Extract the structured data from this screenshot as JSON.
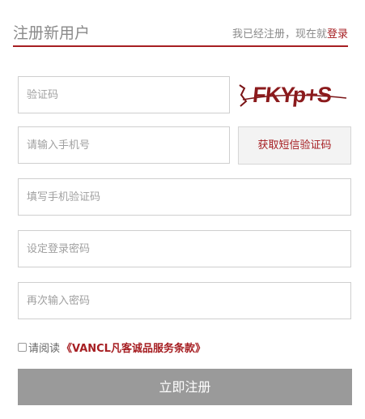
{
  "header": {
    "title": "注册新用户",
    "prompt": "我已经注册，现在就",
    "login_link": "登录"
  },
  "form": {
    "captcha_placeholder": "验证码",
    "captcha_image_text": "FKYp+S",
    "phone_placeholder": "请输入手机号",
    "sms_button": "获取短信验证码",
    "sms_code_placeholder": "填写手机验证码",
    "password_placeholder": "设定登录密码",
    "confirm_password_placeholder": "再次输入密码"
  },
  "agreement": {
    "checked": false,
    "prefix": "请阅读",
    "terms_link": "《VANCL凡客诚品服务条款》"
  },
  "submit": {
    "label": "立即注册"
  },
  "colors": {
    "accent": "#a61e22",
    "submit_bg": "#9a9a9a",
    "border": "#cfcfcf"
  }
}
